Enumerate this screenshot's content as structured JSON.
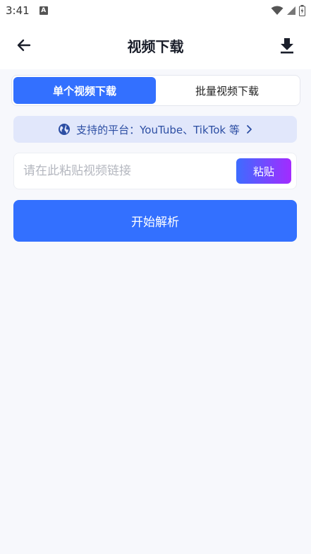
{
  "status_bar": {
    "time": "3:41",
    "notification_badge": "A"
  },
  "app_bar": {
    "title": "视频下载"
  },
  "tabs": [
    {
      "label": "单个视频下载",
      "active": true
    },
    {
      "label": "批量视频下载",
      "active": false
    }
  ],
  "platform_banner": {
    "text": "支持的平台：YouTube、TikTok 等"
  },
  "url_input": {
    "value": "",
    "placeholder": "请在此粘贴视频链接"
  },
  "paste_button": {
    "label": "粘贴"
  },
  "parse_button": {
    "label": "开始解析"
  },
  "colors": {
    "primary": "#3370ff",
    "banner_bg": "#e1e7fb",
    "banner_text": "#2c4ea3",
    "paste_gradient_start": "#3d6cff",
    "paste_gradient_end": "#a32bff",
    "page_bg": "#f7f8fc"
  }
}
